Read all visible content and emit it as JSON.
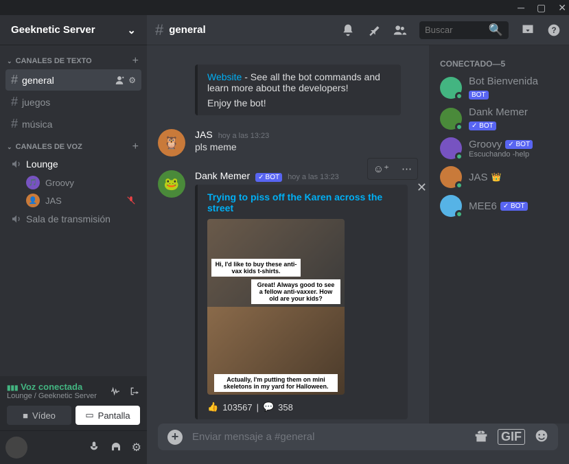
{
  "server_name": "Geeknetic Server",
  "channel_header": "general",
  "categories": {
    "text": {
      "label": "CANALES DE TEXTO",
      "items": [
        {
          "name": "general",
          "active": true
        },
        {
          "name": "juegos"
        },
        {
          "name": "música"
        }
      ]
    },
    "voice": {
      "label": "CANALES DE VOZ",
      "items": [
        {
          "name": "Lounge",
          "users": [
            {
              "name": "Groovy",
              "color": "#5865f2"
            },
            {
              "name": "JAS",
              "muted": true,
              "color": "#c97a3a"
            }
          ]
        },
        {
          "name": "Sala de transmisión"
        }
      ]
    }
  },
  "voice_panel": {
    "status": "Voz conectada",
    "sub": "Lounge / Geeknetic Server",
    "video_btn": "Vídeo",
    "screen_btn": "Pantalla"
  },
  "search_placeholder": "Buscar",
  "messages": [
    {
      "type": "system_embed",
      "website_link": "Website",
      "text1": " - See all the bot commands and learn more about the developers!",
      "text2": "Enjoy the bot!"
    },
    {
      "author": "JAS",
      "time": "hoy a las 13:23",
      "text": "pls meme",
      "avatar_bg": "#c97a3a"
    },
    {
      "author": "Dank Memer",
      "is_bot": true,
      "time": "hoy a las 13:23",
      "avatar_bg": "#4a8a3a",
      "embed": {
        "title": "Trying to piss off the Karen across the street",
        "caption1": "Hi, I'd like to buy these anti-vax kids t-shirts.",
        "caption2": "Great! Always good to see a fellow anti-vaxxer. How old are your kids?",
        "caption3": "Actually, I'm putting them on mini skeletons in my yard for Halloween.",
        "upvotes": "103567",
        "comments": "358"
      }
    }
  ],
  "input_placeholder": "Enviar mensaje a #general",
  "members_header": "CONECTADO—5",
  "members": [
    {
      "name": "Bot Bienvenida",
      "bot": true,
      "verified": false,
      "avatar_bg": "#43b581"
    },
    {
      "name": "Dank Memer",
      "bot": true,
      "verified": true,
      "avatar_bg": "#4a8a3a"
    },
    {
      "name": "Groovy",
      "bot": true,
      "verified": true,
      "avatar_bg": "#7753c1",
      "activity": "Escuchando -help"
    },
    {
      "name": "JAS",
      "crown": true,
      "avatar_bg": "#c97a3a"
    },
    {
      "name": "MEE6",
      "bot": true,
      "verified": true,
      "avatar_bg": "#56b3e6"
    }
  ],
  "bot_label": "BOT"
}
